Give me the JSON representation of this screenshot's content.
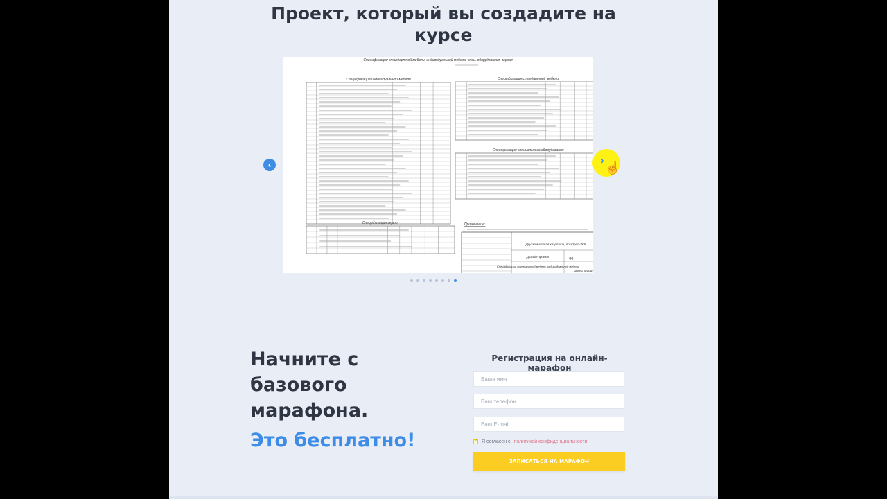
{
  "section": {
    "title_line1": "Проект, который вы создадите на",
    "title_line2": "курсе"
  },
  "slider": {
    "prev_arrow": "‹",
    "next_arrow": "›",
    "slide_count": 8,
    "active_index": 7,
    "slide": {
      "title": "Спецификации стандартной мебели, индивидуальной мебели, спец. оборудования, зеркал",
      "blocks": {
        "individual": "Спецификация индивидуальной мебели",
        "standard": "Спецификация стандартной мебели",
        "equipment": "Спецификация специального оборудования",
        "mirrors": "Спецификация зеркал",
        "notes": "Примечание:"
      },
      "stamp": {
        "address": "Двухкомнатная квартира, по адресу ЖК",
        "project": "Дизайн-проект",
        "sheet_code": "РД",
        "school": "Школа Марины",
        "sheet_title": "Спецификации стандартной мебели, индивидуальной мебели"
      }
    }
  },
  "promo": {
    "line1": "Начните с",
    "line2": "базового",
    "line3": "марафона.",
    "free": "Это бесплатно!"
  },
  "form": {
    "title": "Регистрация на онлайн-марафон",
    "name_placeholder": "Ваше имя",
    "phone_placeholder": "Ваш телефон",
    "email_placeholder": "Ваш E-mail",
    "consent_text": "Я согласен с",
    "consent_link": "политикой конфиденциальности",
    "submit_label": "ЗАПИСАТЬСЯ НА МАРАФОН"
  },
  "colors": {
    "accent_blue": "#3d8ce6",
    "accent_yellow": "#fbcd23",
    "page_background": "#e9edf6",
    "heading": "#2f3542"
  }
}
